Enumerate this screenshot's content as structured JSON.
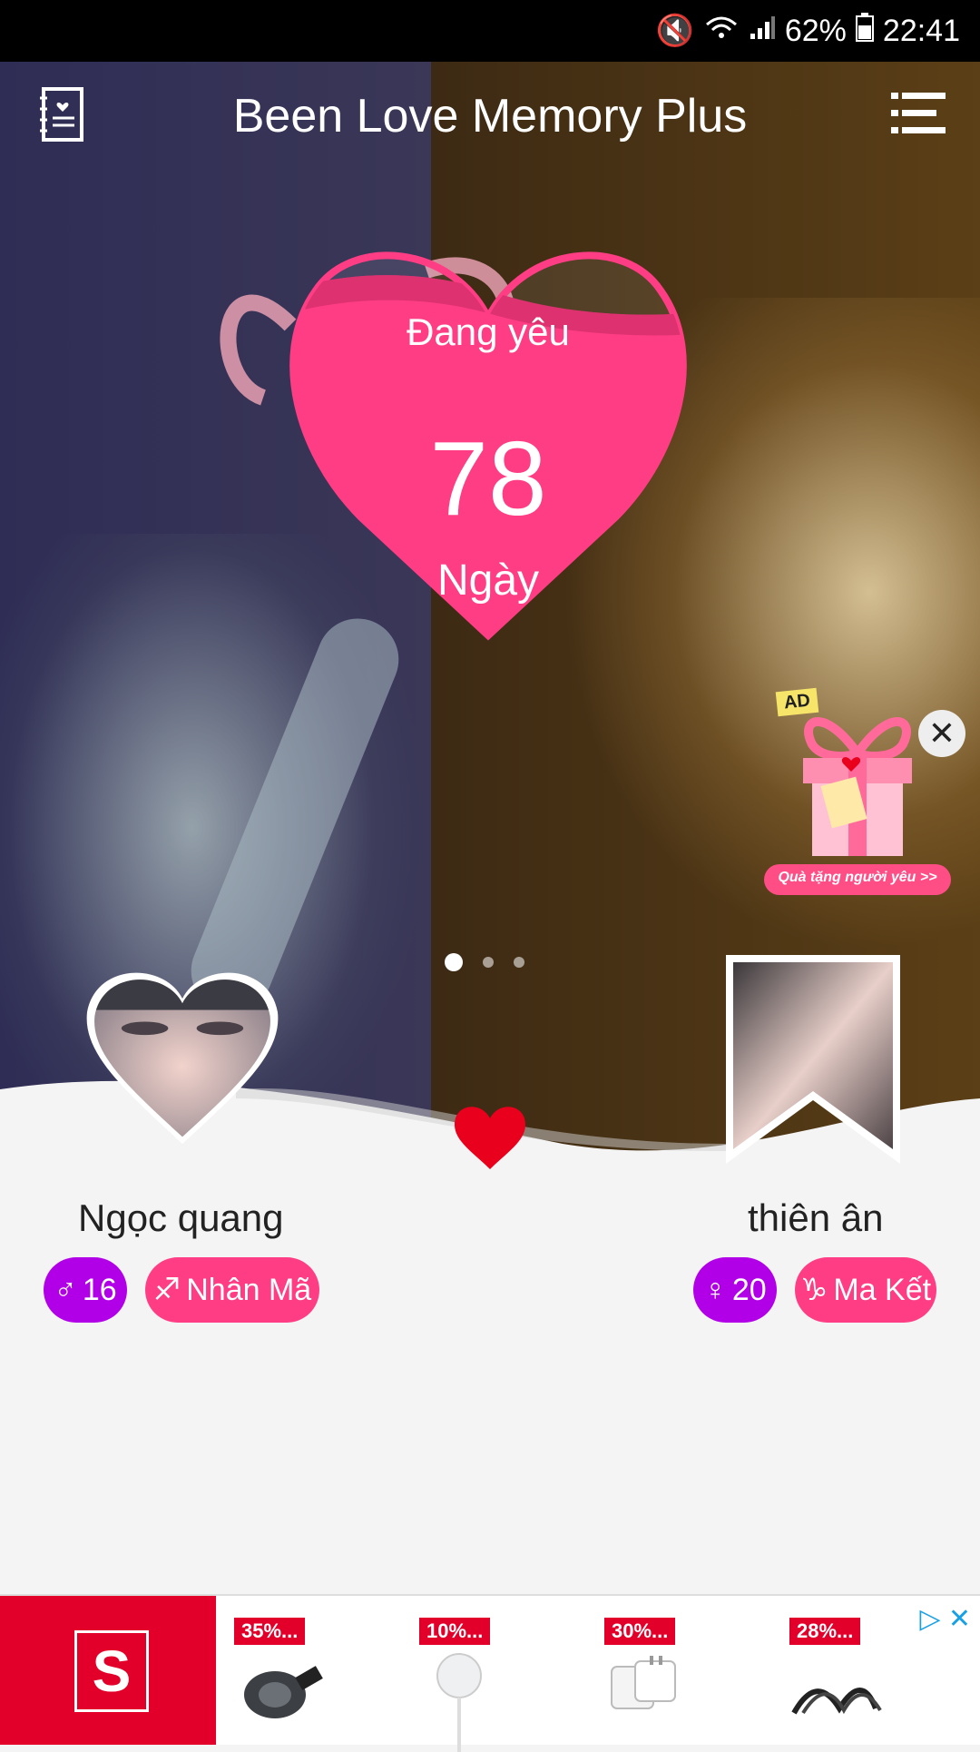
{
  "status": {
    "battery": "62%",
    "time": "22:41"
  },
  "appbar": {
    "title": "Been Love Memory Plus"
  },
  "counter": {
    "top_label": "Đang yêu",
    "days": "78",
    "unit": "Ngày"
  },
  "ad_gift": {
    "badge": "AD",
    "caption": "Quà tặng người yêu >>"
  },
  "person_left": {
    "name": "Ngọc quang",
    "age": "16",
    "zodiac": "Nhân Mã",
    "gender_icon": "♂",
    "zodiac_icon": "♐"
  },
  "person_right": {
    "name": "thiên ân",
    "age": "20",
    "zodiac": "Ma Kết",
    "gender_icon": "♀",
    "zodiac_icon": "♑"
  },
  "ad_banner": {
    "tags": [
      "35%...",
      "10%...",
      "30%...",
      "28%..."
    ],
    "logo_letter": "S"
  },
  "colors": {
    "accent_pink": "#ff3d84",
    "purple": "#b100e8",
    "heart_red": "#e8001c"
  }
}
